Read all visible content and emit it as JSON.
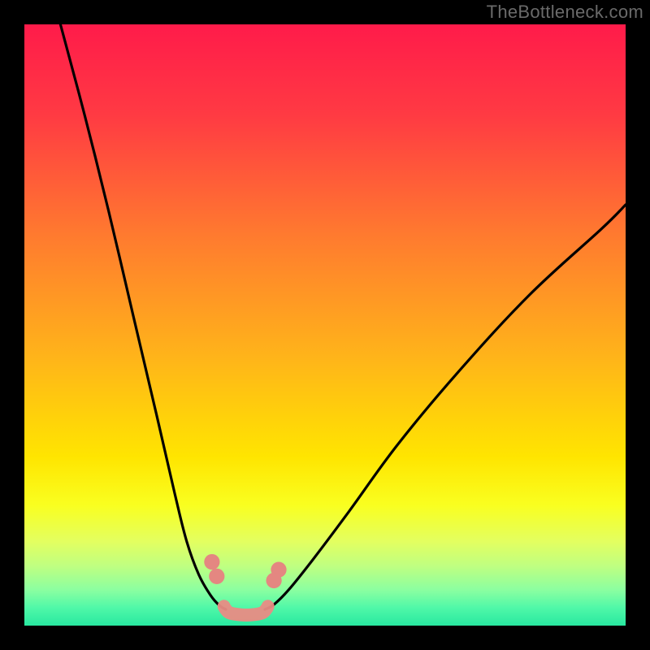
{
  "watermark": "TheBottleneck.com",
  "chart_data": {
    "type": "line",
    "title": "",
    "xlabel": "",
    "ylabel": "",
    "xlim": [
      0,
      100
    ],
    "ylim": [
      0,
      100
    ],
    "grid": false,
    "legend": false,
    "background_gradient_stops": [
      {
        "pos": 0.0,
        "color": "#ff1b4a"
      },
      {
        "pos": 0.15,
        "color": "#ff3a43"
      },
      {
        "pos": 0.35,
        "color": "#ff7a2f"
      },
      {
        "pos": 0.55,
        "color": "#ffb31a"
      },
      {
        "pos": 0.72,
        "color": "#ffe500"
      },
      {
        "pos": 0.8,
        "color": "#f9ff20"
      },
      {
        "pos": 0.86,
        "color": "#e3ff60"
      },
      {
        "pos": 0.9,
        "color": "#c0ff80"
      },
      {
        "pos": 0.94,
        "color": "#8cffa0"
      },
      {
        "pos": 0.97,
        "color": "#50f8a8"
      },
      {
        "pos": 1.0,
        "color": "#28e8a0"
      }
    ],
    "series": [
      {
        "name": "left-curve",
        "color": "#000000",
        "x": [
          6,
          10,
          14,
          18,
          22,
          25,
          27,
          29,
          31,
          32.5,
          33.5
        ],
        "y": [
          100,
          85,
          69,
          52,
          35,
          22,
          14,
          8.5,
          5,
          3.3,
          2.7
        ]
      },
      {
        "name": "right-curve",
        "color": "#000000",
        "x": [
          40,
          41.5,
          44,
          48,
          54,
          62,
          72,
          84,
          96,
          100
        ],
        "y": [
          2.7,
          3.5,
          6,
          11,
          19,
          30,
          42,
          55,
          66,
          70
        ]
      },
      {
        "name": "coral-band",
        "color": "#e98b84",
        "x": [
          33.2,
          33.5,
          34.2,
          36.0,
          37.8,
          39.5,
          40.2,
          40.5
        ],
        "y": [
          3.2,
          2.7,
          2.1,
          1.8,
          1.8,
          2.1,
          2.7,
          3.2
        ]
      }
    ],
    "markers": [
      {
        "name": "left-dot-upper",
        "x": 31.2,
        "y": 10.6,
        "r": 1.3,
        "color": "#e48781"
      },
      {
        "name": "left-dot-lower",
        "x": 32.0,
        "y": 8.2,
        "r": 1.3,
        "color": "#e48781"
      },
      {
        "name": "right-dot-upper",
        "x": 42.3,
        "y": 9.3,
        "r": 1.3,
        "color": "#e48781"
      },
      {
        "name": "right-dot-lower",
        "x": 41.5,
        "y": 7.5,
        "r": 1.3,
        "color": "#e48781"
      }
    ]
  }
}
